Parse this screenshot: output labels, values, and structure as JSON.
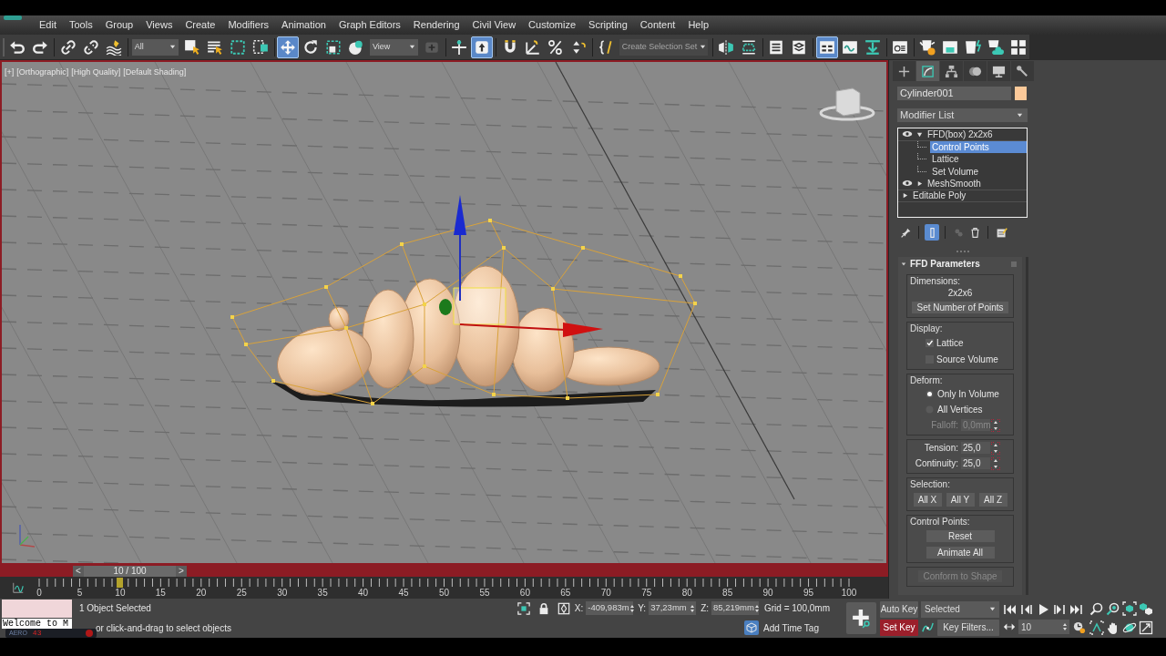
{
  "menu_bar": {
    "items": [
      "Edit",
      "Tools",
      "Group",
      "Views",
      "Create",
      "Modifiers",
      "Animation",
      "Graph Editors",
      "Rendering",
      "Civil View",
      "Customize",
      "Scripting",
      "Content",
      "Help"
    ]
  },
  "main_toolbar": {
    "groups": [
      [
        {
          "kind": "button",
          "selected": false
        },
        {
          "kind": "button",
          "selected": false
        }
      ],
      [
        {
          "kind": "button",
          "selected": false
        },
        {
          "kind": "button",
          "selected": false
        },
        {
          "kind": "button",
          "selected": false
        }
      ],
      [
        {
          "kind": "dropdown",
          "value": "All",
          "disabled": false
        },
        {
          "kind": "button",
          "selected": false
        },
        {
          "kind": "button",
          "selected": false
        },
        {
          "kind": "button",
          "selected": false
        },
        {
          "kind": "button",
          "selected": false
        }
      ],
      [
        {
          "kind": "button",
          "selected": true
        },
        {
          "kind": "button",
          "selected": false
        },
        {
          "kind": "button",
          "selected": false
        },
        {
          "kind": "button",
          "selected": false
        },
        {
          "kind": "dropdown",
          "value": "View",
          "disabled": false
        },
        {
          "kind": "button",
          "selected": false
        }
      ],
      [
        {
          "kind": "button",
          "selected": false
        },
        {
          "kind": "button",
          "selected": true
        }
      ],
      [
        {
          "kind": "button",
          "selected": false
        },
        {
          "kind": "button",
          "selected": false
        },
        {
          "kind": "button",
          "selected": false
        },
        {
          "kind": "button",
          "selected": false
        }
      ],
      [
        {
          "kind": "button",
          "selected": false
        },
        {
          "kind": "dropdown",
          "value": "Create Selection Set",
          "disabled": true
        }
      ],
      [
        {
          "kind": "button",
          "selected": false
        },
        {
          "kind": "button",
          "selected": false
        }
      ],
      [
        {
          "kind": "button",
          "selected": false
        },
        {
          "kind": "button",
          "selected": false
        }
      ],
      [
        {
          "kind": "button",
          "selected": true
        },
        {
          "kind": "button",
          "selected": false
        },
        {
          "kind": "button",
          "selected": false
        }
      ],
      [
        {
          "kind": "button",
          "selected": false
        }
      ],
      [
        {
          "kind": "button",
          "selected": false
        },
        {
          "kind": "button",
          "selected": false
        },
        {
          "kind": "button",
          "selected": false
        },
        {
          "kind": "button",
          "selected": false
        },
        {
          "kind": "button",
          "selected": false
        }
      ]
    ]
  },
  "viewport": {
    "labels": [
      "[+]",
      "[Orthographic]",
      "[High Quality]",
      "[Default Shading]"
    ]
  },
  "command_panel": {
    "tabs": [
      {
        "selected": false
      },
      {
        "selected": true
      },
      {
        "selected": false
      },
      {
        "selected": false
      },
      {
        "selected": false
      },
      {
        "selected": false
      }
    ],
    "object": {
      "name": "Cylinder001",
      "color": "#fcc999"
    },
    "modifier_list": "Modifier List",
    "modifier_stack": [
      {
        "kind": "modifier",
        "label": "FFD(box) 2x2x6",
        "expanded": true,
        "selected": false,
        "children": [
          {
            "label": "Control Points",
            "selected": true
          },
          {
            "label": "Lattice",
            "selected": false
          },
          {
            "label": "Set Volume",
            "selected": false
          }
        ]
      },
      {
        "kind": "modifier",
        "label": "MeshSmooth",
        "expanded": false,
        "selected": false
      },
      {
        "kind": "base",
        "label": "Editable Poly",
        "expanded": false,
        "selected": false
      }
    ],
    "stack_tools": [
      {
        "selected": false,
        "disabled": false
      },
      {
        "selected": true,
        "disabled": false
      },
      {
        "selected": false,
        "disabled": true
      },
      {
        "selected": false,
        "disabled": false
      },
      {
        "selected": false,
        "disabled": false
      }
    ],
    "rollout": {
      "title": "FFD Parameters",
      "expanded": true,
      "groups": [
        {
          "label": "Dimensions:",
          "items": [
            {
              "kind": "value",
              "text": "2x2x6"
            },
            {
              "kind": "button",
              "label": "Set Number of Points",
              "disabled": false
            }
          ]
        },
        {
          "label": "Display:",
          "items": [
            {
              "kind": "checkbox",
              "label": "Lattice",
              "checked": true
            },
            {
              "kind": "checkbox",
              "label": "Source Volume",
              "checked": false
            }
          ]
        },
        {
          "label": "Deform:",
          "items": [
            {
              "kind": "radio",
              "label": "Only In Volume",
              "selected": true
            },
            {
              "kind": "radio",
              "label": "All Vertices",
              "selected": false
            },
            {
              "kind": "spinner",
              "label": "Falloff:",
              "value": "0,0mm",
              "disabled": true
            }
          ]
        },
        {
          "items": [
            {
              "kind": "spinner",
              "label": "Tension:",
              "value": "25,0",
              "disabled": false
            },
            {
              "kind": "spinner",
              "label": "Continuity:",
              "value": "25,0",
              "disabled": false
            }
          ]
        },
        {
          "label": "Selection:",
          "items": [
            {
              "kind": "buttons",
              "buttons": [
                {
                  "label": "All X"
                },
                {
                  "label": "All Y"
                },
                {
                  "label": "All Z"
                }
              ]
            }
          ]
        },
        {
          "label": "Control Points:",
          "items": [
            {
              "kind": "button",
              "label": "Reset",
              "disabled": false
            },
            {
              "kind": "button",
              "label": "Animate All",
              "disabled": false
            }
          ]
        },
        {
          "items": [
            {
              "kind": "button",
              "label": "Conform to Shape",
              "disabled": true
            }
          ]
        }
      ]
    }
  },
  "time_slider": {
    "previous": "<",
    "frame": "10 / 100",
    "next": ">",
    "level": 0.1
  },
  "track_bar": {
    "labels": [
      "0",
      "5",
      "10",
      "15",
      "20",
      "25",
      "30",
      "35",
      "40",
      "45",
      "50",
      "55",
      "60",
      "65",
      "70",
      "75",
      "80",
      "85",
      "90",
      "95",
      "100"
    ],
    "level": 0.1
  },
  "status_bar": {
    "listener_output": "Welcome to M",
    "overlay_widget": {
      "label": "AERO",
      "value": "43"
    },
    "selection_info": "1 Object Selected",
    "prompt": "or click-and-drag to select objects",
    "coordinates": [
      {
        "label": "X:",
        "value": "-409,983m"
      },
      {
        "label": "Y:",
        "value": "37,23mm"
      },
      {
        "label": "Z:",
        "value": "85,219mm"
      }
    ],
    "grid": "Grid = 100,0mm",
    "time_tag": "Add Time Tag"
  },
  "animation_controls": {
    "auto_key": {
      "label": "Auto Key",
      "selected": false
    },
    "set_key": {
      "label": "Set Key",
      "selected": true
    },
    "key_set": "Selected",
    "key_filters": "Key Filters...",
    "current_frame": "10"
  }
}
